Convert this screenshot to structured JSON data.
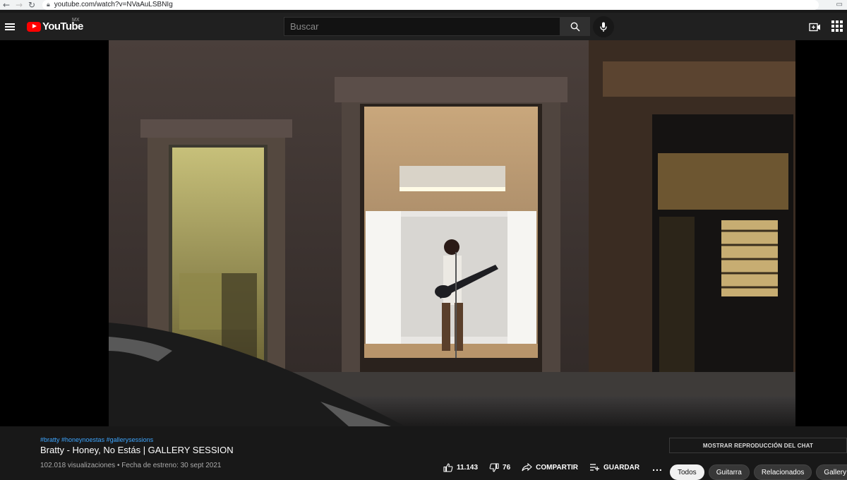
{
  "browser": {
    "url": "youtube.com/watch?v=NVaAuLSBNIg"
  },
  "header": {
    "logo_text": "YouTube",
    "country_code": "MX",
    "search_placeholder": "Buscar"
  },
  "video": {
    "hashtags": "#bratty #honeynoestas #gallerysessions",
    "title": "Bratty - Honey, No Estás | GALLERY SESSION",
    "meta": "102.018 visualizaciones • Fecha de estreno: 30 sept 2021",
    "likes": "11.143",
    "dislikes": "76",
    "share_label": "COMPARTIR",
    "save_label": "GUARDAR",
    "more_label": "..."
  },
  "sidebar": {
    "chat_replay_label": "MOSTRAR REPRODUCCIÓN DEL CHAT",
    "chips": [
      "Todos",
      "Guitarra",
      "Relacionados",
      "Gallery S"
    ]
  }
}
